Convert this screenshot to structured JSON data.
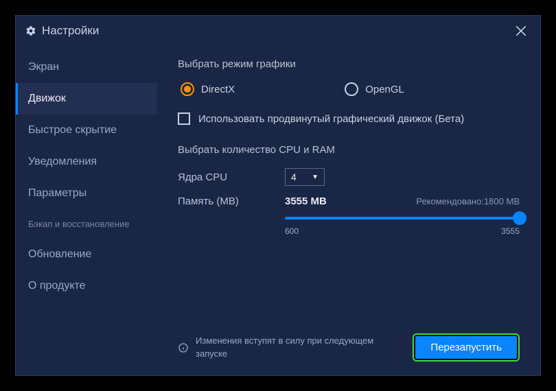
{
  "window": {
    "title": "Настройки"
  },
  "sidebar": {
    "items": [
      {
        "label": "Экран"
      },
      {
        "label": "Движок"
      },
      {
        "label": "Быстрое скрытие"
      },
      {
        "label": "Уведомления"
      },
      {
        "label": "Параметры"
      },
      {
        "label": "Бэкап и восстановление"
      },
      {
        "label": "Обновление"
      },
      {
        "label": "О продукте"
      }
    ]
  },
  "graphics": {
    "title": "Выбрать режим графики",
    "directx": "DirectX",
    "opengl": "OpenGL",
    "advanced_checkbox": "Использовать продвинутый графический движок (Бета)"
  },
  "cpu_ram": {
    "title": "Выбрать количество CPU и RAM",
    "cores_label": "Ядра CPU",
    "cores_value": "4",
    "memory_label": "Память (MB)",
    "memory_value": "3555 MB",
    "recommended": "Рекомендовано:1800 MB",
    "slider_min": "600",
    "slider_max": "3555"
  },
  "footer": {
    "info": "Изменения вступят в силу при следующем запуске",
    "restart": "Перезапустить"
  }
}
